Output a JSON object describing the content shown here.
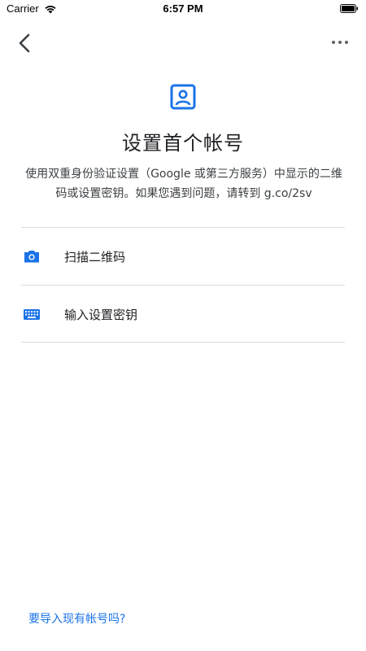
{
  "status_bar": {
    "carrier": "Carrier",
    "time": "6:57 PM"
  },
  "nav": {
    "back_icon": "chevron-left-icon",
    "more_icon": "more-horiz-icon"
  },
  "header": {
    "icon": "account-box-icon",
    "title": "设置首个帐号",
    "description": "使用双重身份验证设置（Google 或第三方服务）中显示的二维码或设置密钥。如果您遇到问题，请转到 g.co/2sv"
  },
  "options": [
    {
      "icon": "camera-icon",
      "label": "扫描二维码"
    },
    {
      "icon": "keyboard-icon",
      "label": "输入设置密钥"
    }
  ],
  "footer": {
    "import_link": "要导入现有帐号吗?"
  },
  "colors": {
    "accent": "#1a73e8",
    "divider": "#dadce0",
    "text": "#202124"
  }
}
